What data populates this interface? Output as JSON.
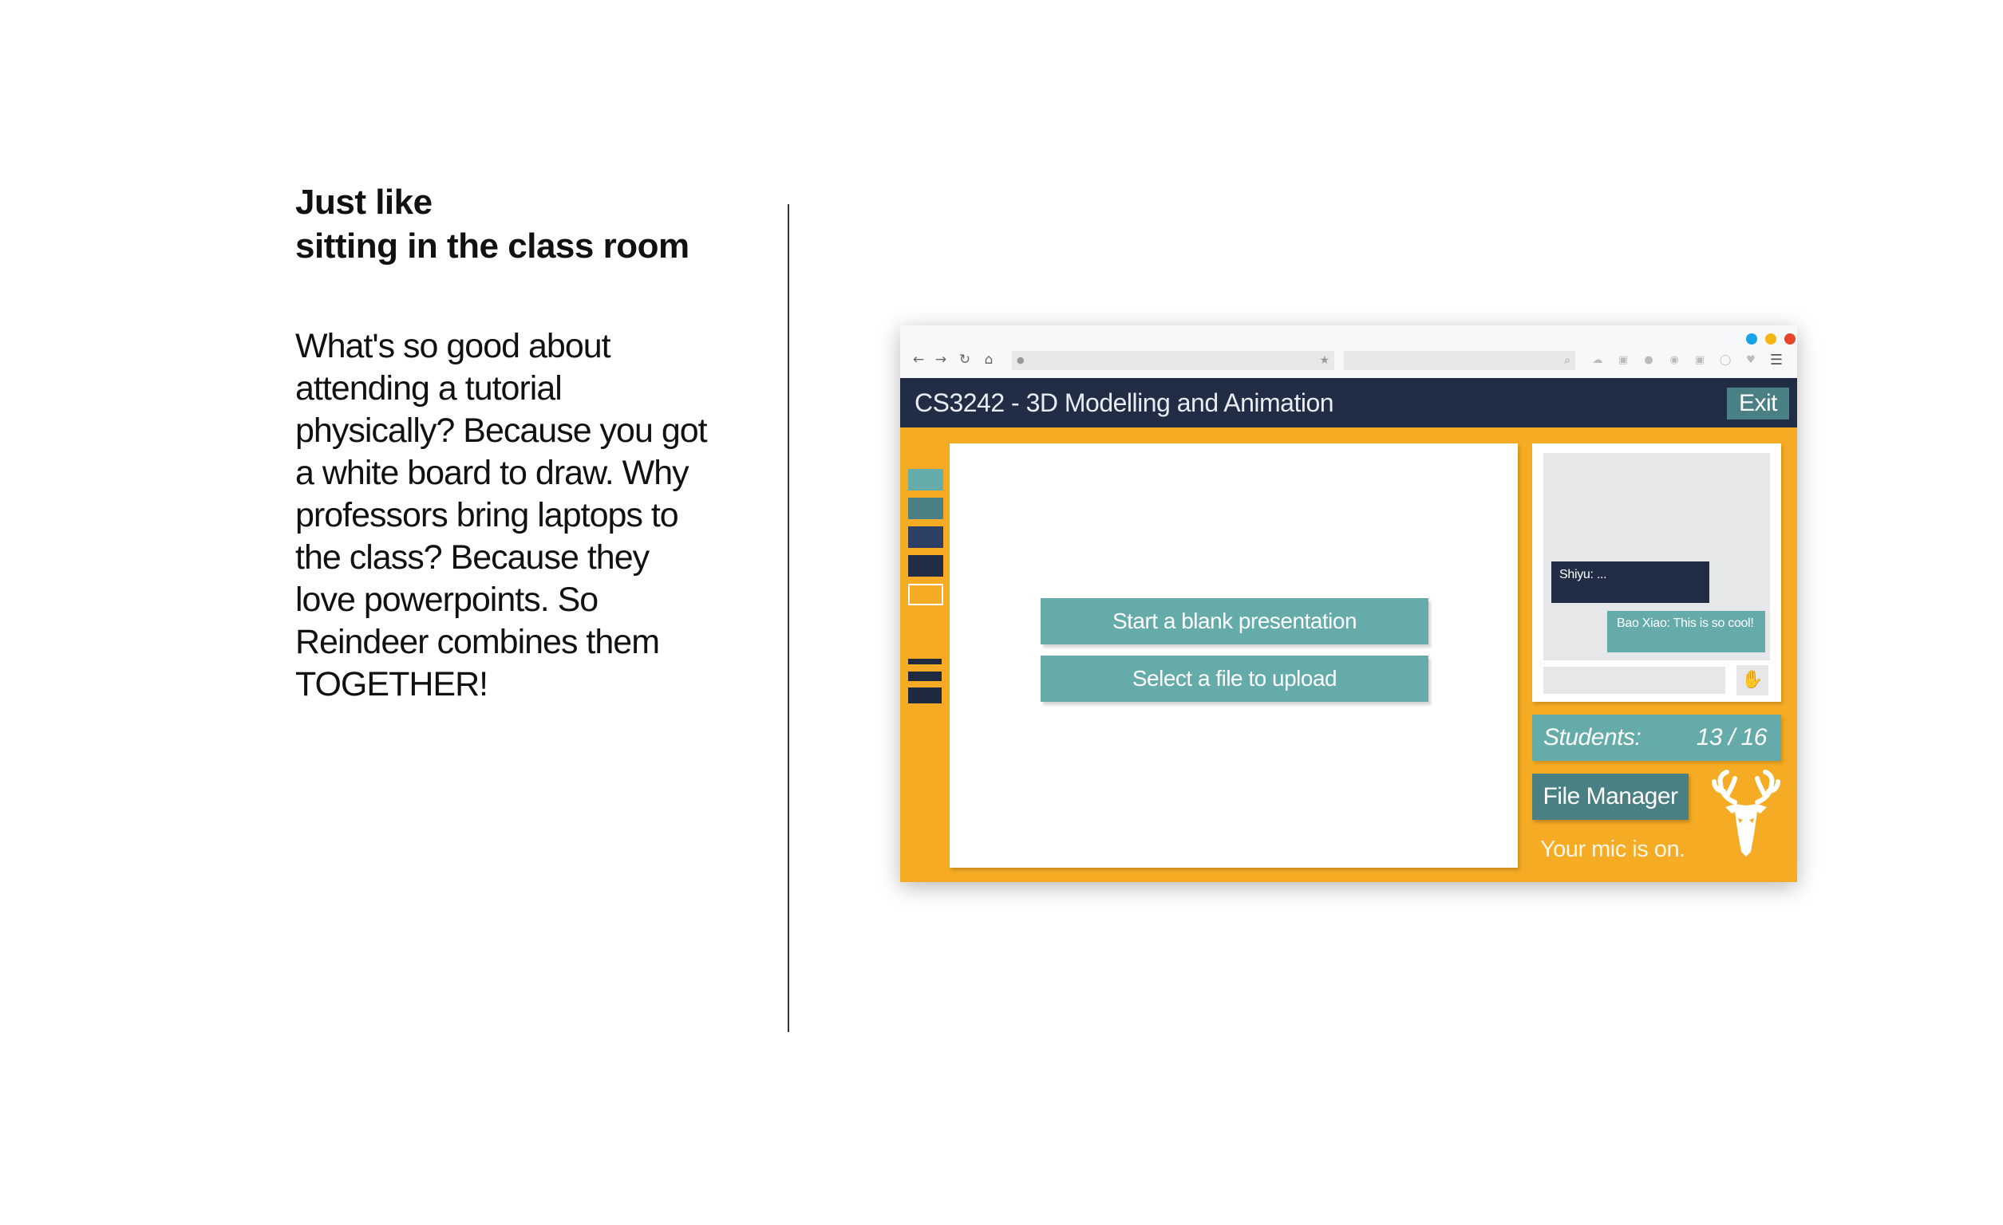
{
  "slide": {
    "heading_line1": "Just like",
    "heading_line2": "sitting in the class room",
    "body_lines": [
      "What's so good about",
      "attending a tutorial",
      "physically? Because you got",
      "a white board to draw. Why",
      "professors bring laptops to",
      "the class? Because they",
      "love powerpoints. So",
      "Reindeer combines them",
      "TOGETHER!"
    ]
  },
  "browser": {
    "dot_colors": [
      "#1aa3e8",
      "#f5b514",
      "#e8442a"
    ],
    "nav_icons": [
      "back-arrow-icon",
      "forward-arrow-icon",
      "reload-icon",
      "home-icon"
    ],
    "toolbar_icons": [
      "cloud-icon",
      "screenshot-icon",
      "circle-icon",
      "ghost-icon",
      "camera-icon",
      "shield-icon",
      "heart-icon",
      "menu-icon"
    ]
  },
  "app": {
    "course_title": "CS3242 - 3D Modelling and Animation",
    "exit_label": "Exit",
    "tool_swatches": [
      "#64aba9",
      "#4a7f84",
      "#2c4066",
      "#212c45",
      "#f5ab23"
    ],
    "whiteboard": {
      "blank_btn": "Start a blank presentation",
      "upload_btn": "Select a file to upload"
    },
    "chat": {
      "msg1": "Shiyu: ...",
      "msg2": "Bao Xiao: This is so cool!"
    },
    "students_label": "Students:",
    "students_count": "13 / 16",
    "file_manager": "File Manager",
    "mic_status": "Your mic is on."
  },
  "colors": {
    "navy": "#212c45",
    "orange": "#f5ab23",
    "teal": "#64aba9",
    "dark_teal": "#4a7f84"
  }
}
